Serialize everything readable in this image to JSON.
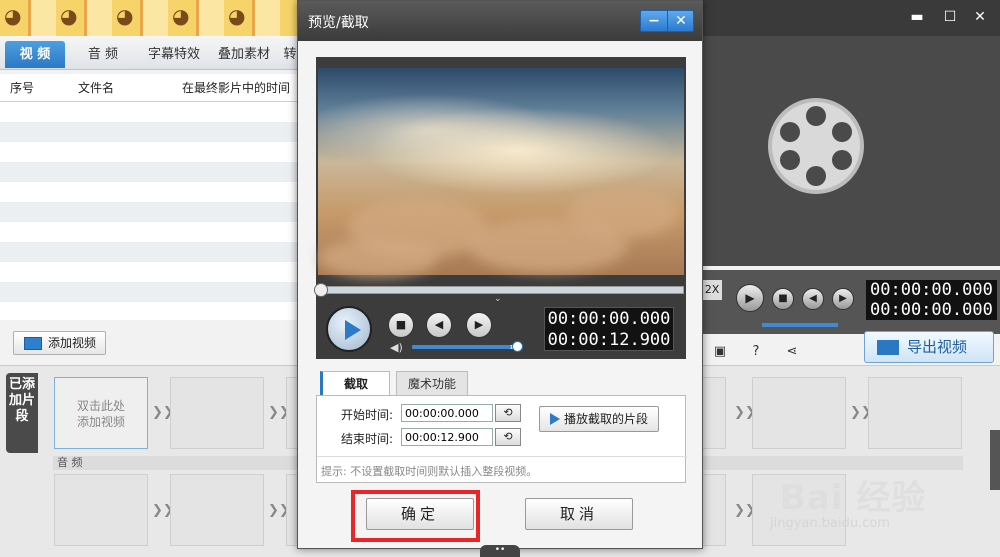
{
  "main_window": {
    "tabs": [
      {
        "label": "视 频"
      },
      {
        "label": "音 频"
      },
      {
        "label": "字幕特效"
      },
      {
        "label": "叠加素材"
      },
      {
        "label": "转"
      }
    ],
    "table_columns": [
      "序号",
      "文件名",
      "在最终影片中的时间"
    ],
    "add_video_label": "添加视频",
    "side_label": "已添加片段",
    "first_slot_text": "双击此处\n添加视频",
    "audio_track_label": "音 频",
    "timecode_1": "00:00:00.000",
    "timecode_2": "00:00:00.000",
    "speed_label": "2X",
    "export_label": "导出视频"
  },
  "dialog": {
    "title": "预览/截取",
    "timecode_current": "00:00:00.000",
    "timecode_total": "00:00:12.900",
    "tabs": [
      {
        "label": "截取",
        "active": true
      },
      {
        "label": "魔术功能",
        "active": false
      }
    ],
    "start_label": "开始时间:",
    "start_value": "00:00:00.000",
    "end_label": "结束时间:",
    "end_value": "00:00:12.900",
    "play_segment_label": "播放截取的片段",
    "hint": "提示: 不设置截取时间则默认插入整段视频。",
    "ok_label": "确定",
    "cancel_label": "取消",
    "volume_level": 0.95
  },
  "watermark": {
    "brand": "Bai 经验",
    "url": "jingyan.baidu.com"
  },
  "colors": {
    "accent": "#2a78c2",
    "highlight": "#e8262a"
  }
}
